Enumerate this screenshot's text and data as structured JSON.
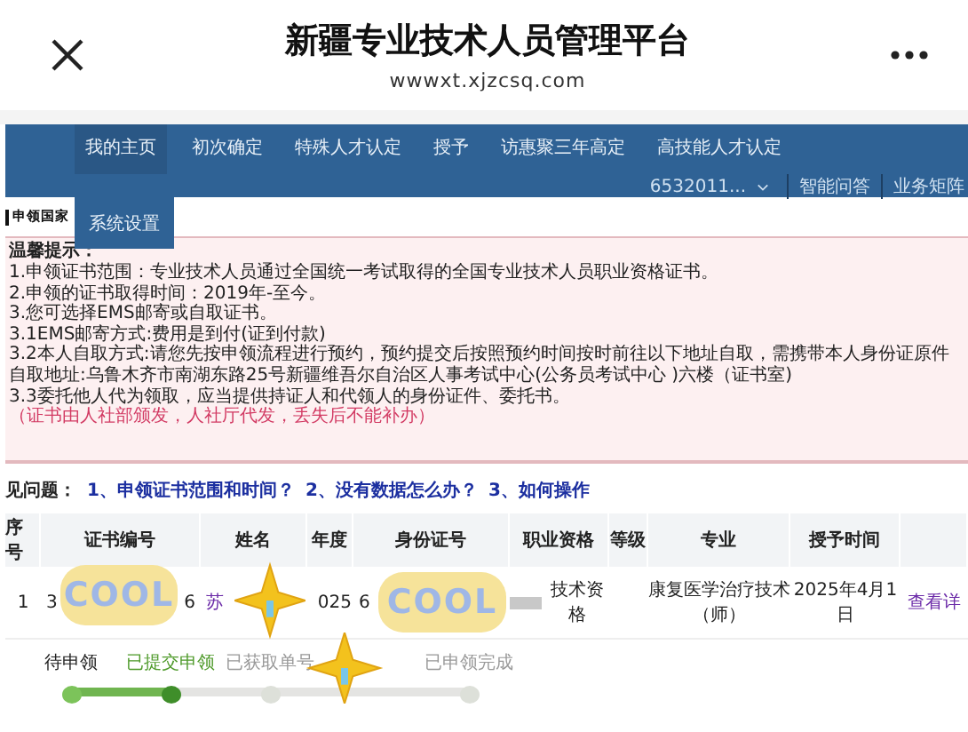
{
  "app_bar": {
    "title": "新疆专业技术人员管理平台",
    "subtitle": "wwwxt.xjzcsq.com"
  },
  "nav": {
    "items": [
      {
        "label": "我的主页",
        "selected": true
      },
      {
        "label": "初次确定",
        "selected": false
      },
      {
        "label": "特殊人才认定",
        "selected": false
      },
      {
        "label": "授予",
        "selected": false
      },
      {
        "label": "访惠聚三年高定",
        "selected": false
      },
      {
        "label": "高技能人才认定",
        "selected": false
      }
    ],
    "dropdown": {
      "label": "系统设置"
    },
    "user": "6532011...",
    "links": [
      "智能问答",
      "业务矩阵"
    ]
  },
  "page_heading": "申领国家",
  "notice": {
    "title": "温馨提示：",
    "lines": [
      {
        "text": "1.申领证书范围：专业技术人员通过全国统一考试取得的全国专业技术人员职业资格证书。",
        "kind": "normal"
      },
      {
        "text": "2.申领的证书取得时间：2019年-至今。",
        "kind": "normal"
      },
      {
        "text": "3.您可选择EMS邮寄或自取证书。",
        "kind": "normal"
      },
      {
        "text": "3.1EMS邮寄方式:费用是到付(证到付款)",
        "kind": "normal"
      },
      {
        "text": "3.2本人自取方式:请您先按申领流程进行预约，预约提交后按照预约时间按时前往以下地址自取，需携带本人身份证原件",
        "kind": "normal"
      },
      {
        "text": "自取地址:乌鲁木齐市南湖东路25号新疆维吾尔自治区人事考试中心(公务员考试中心 )六楼（证书室)",
        "kind": "normal"
      },
      {
        "text": "3.3委托他人代为领取，应当提供持证人和代领人的身份证件、委托书。",
        "kind": "normal"
      },
      {
        "text": "（证书由人社部颁发，人社厅代发，丢失后不能补办）",
        "kind": "warning"
      }
    ]
  },
  "faq": {
    "label": "见问题：",
    "links": [
      "1、申领证书范围和时间？",
      "2、没有数据怎么办？",
      "3、如何操作"
    ]
  },
  "table": {
    "columns": [
      "序号",
      "证书编号",
      "姓名",
      "年度",
      "身份证号",
      "职业资格",
      "等级",
      "专业",
      "授予时间"
    ],
    "rows": [
      {
        "cells": [
          {
            "kind": "text",
            "parts": [
              "1"
            ]
          },
          {
            "kind": "text",
            "parts": [
              "3",
              "6"
            ]
          },
          {
            "kind": "link",
            "parts": [
              "苏"
            ]
          },
          {
            "kind": "text",
            "parts": [
              "025"
            ]
          },
          {
            "kind": "text",
            "parts": [
              "6"
            ]
          },
          {
            "kind": "blurred",
            "parts": [
              "技术资格"
            ]
          },
          {
            "kind": "text"
          },
          {
            "kind": "text",
            "parts": [
              "康复医学治疗技术（师）"
            ]
          },
          {
            "kind": "text",
            "parts": [
              "2025年4月1日"
            ]
          },
          {
            "kind": "link",
            "parts": [
              "查看详"
            ]
          }
        ]
      }
    ]
  },
  "steps": [
    {
      "label": "待申领",
      "done": true,
      "selected": false
    },
    {
      "label": "已提交申领",
      "done": true,
      "selected": true
    },
    {
      "label": "已获取单号",
      "done": false,
      "selected": false
    },
    {
      "label": "已申领完成",
      "done": false,
      "selected": false
    }
  ],
  "stickers": [
    {
      "kind": "cool",
      "text": "COOL"
    },
    {
      "kind": "cool",
      "text": "COOL"
    },
    {
      "kind": "star"
    },
    {
      "kind": "star"
    }
  ]
}
